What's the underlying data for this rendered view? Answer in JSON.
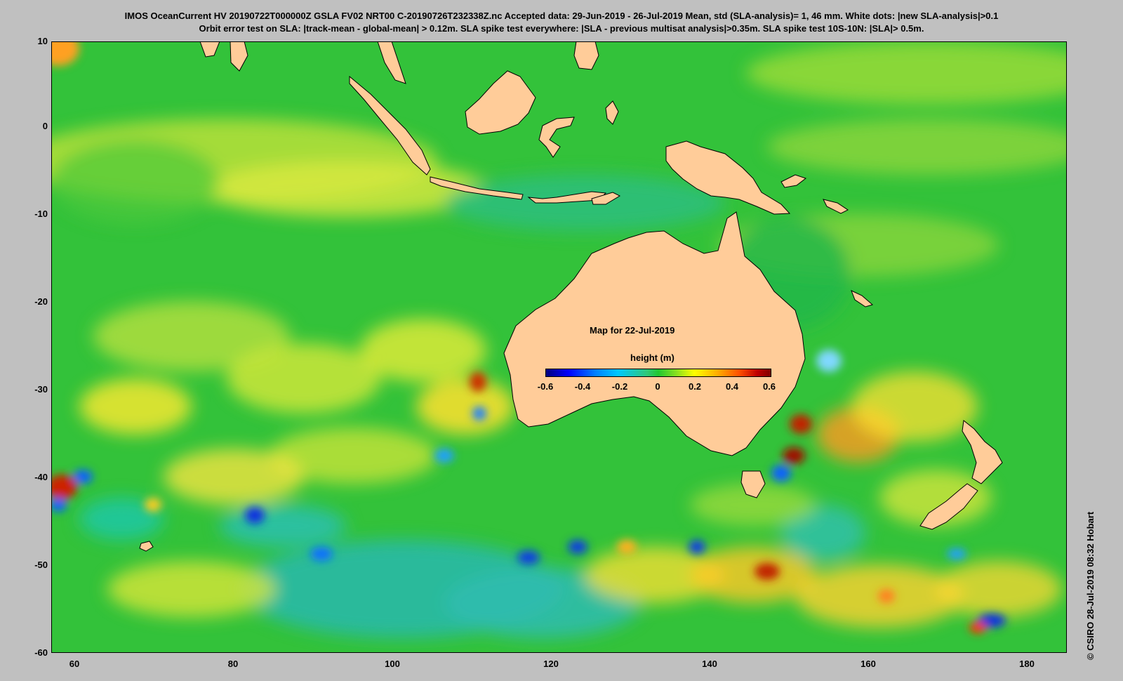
{
  "header": {
    "line1": "IMOS OceanCurrent HV 20190722T000000Z GSLA FV02 NRT00 C-20190726T232338Z.nc  Accepted data: 29-Jun-2019 - 26-Jul-2019 Mean, std (SLA-analysis)= 1, 46 mm. White dots: |new SLA-analysis|>0.1",
    "line2": "Orbit error test on SLA: |track-mean  - global-mean| > 0.12m.  SLA spike test everywhere: |SLA - previous multisat analysis|>0.35m. SLA spike test 10S-10N: |SLA|> 0.5m."
  },
  "map": {
    "label": "Map for 22-Jul-2019",
    "x_ticks": [
      "60",
      "80",
      "100",
      "120",
      "140",
      "160",
      "180"
    ],
    "y_ticks": [
      "10",
      "0",
      "-10",
      "-20",
      "-30",
      "-40",
      "-50",
      "-60"
    ],
    "lon_range": [
      57,
      185
    ],
    "lat_range": [
      -60,
      10
    ],
    "land_color": "#ffcc99",
    "ocean_base_color": "#33c23a"
  },
  "colorbar": {
    "title": "height (m)",
    "ticks": [
      "-0.6",
      "-0.4",
      "-0.2",
      "0",
      "0.2",
      "0.4",
      "0.6"
    ],
    "range": [
      -0.6,
      0.6
    ]
  },
  "credit": "© CSIRO 28-Jul-2019 08:32 Hobart"
}
